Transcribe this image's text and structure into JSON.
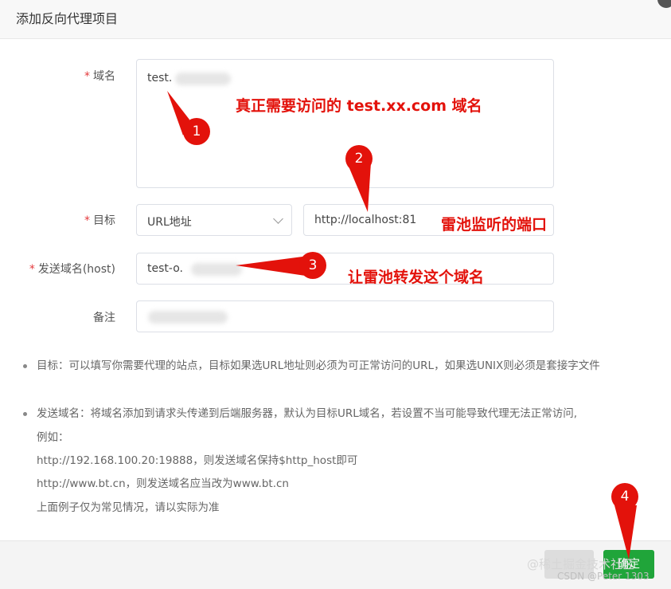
{
  "dialog": {
    "title": "添加反向代理项目"
  },
  "form": {
    "domain": {
      "required_mark": "*",
      "label": "域名",
      "value": "test."
    },
    "target": {
      "required_mark": "*",
      "label": "目标",
      "type_selected": "URL地址",
      "url_value": "http://localhost:81"
    },
    "host": {
      "required_mark": "*",
      "label": "发送域名(host)",
      "value": "test-o."
    },
    "remark": {
      "label": "备注"
    }
  },
  "notes": {
    "target": "目标：可以填写你需要代理的站点，目标如果选URL地址则必须为可正常访问的URL，如果选UNIX则必须是套接字文件",
    "host_line1": "发送域名：将域名添加到请求头传递到后端服务器，默认为目标URL域名，若设置不当可能导致代理无法正常访问,",
    "host_line2": "例如：",
    "host_line3": "http://192.168.100.20:19888，则发送域名保持$http_host即可",
    "host_line4": "http://www.bt.cn，则发送域名应当改为www.bt.cn",
    "host_line5": "上面例子仅为常见情况，请以实际为准"
  },
  "buttons": {
    "ok": "确定"
  },
  "annotations": {
    "a1": "真正需要访问的 test.xx.com 域名",
    "a2": "雷池监听的端口",
    "a3": "让雷池转发这个域名",
    "n1": "1",
    "n2": "2",
    "n3": "3",
    "n4": "4"
  },
  "watermark": {
    "juejin": "@稀土掘金技术社区",
    "csdn": "CSDN @Peter 1303"
  },
  "colors": {
    "annotation_red": "#e3120b",
    "ok_green": "#20a53a",
    "required_red": "#e4393c"
  }
}
